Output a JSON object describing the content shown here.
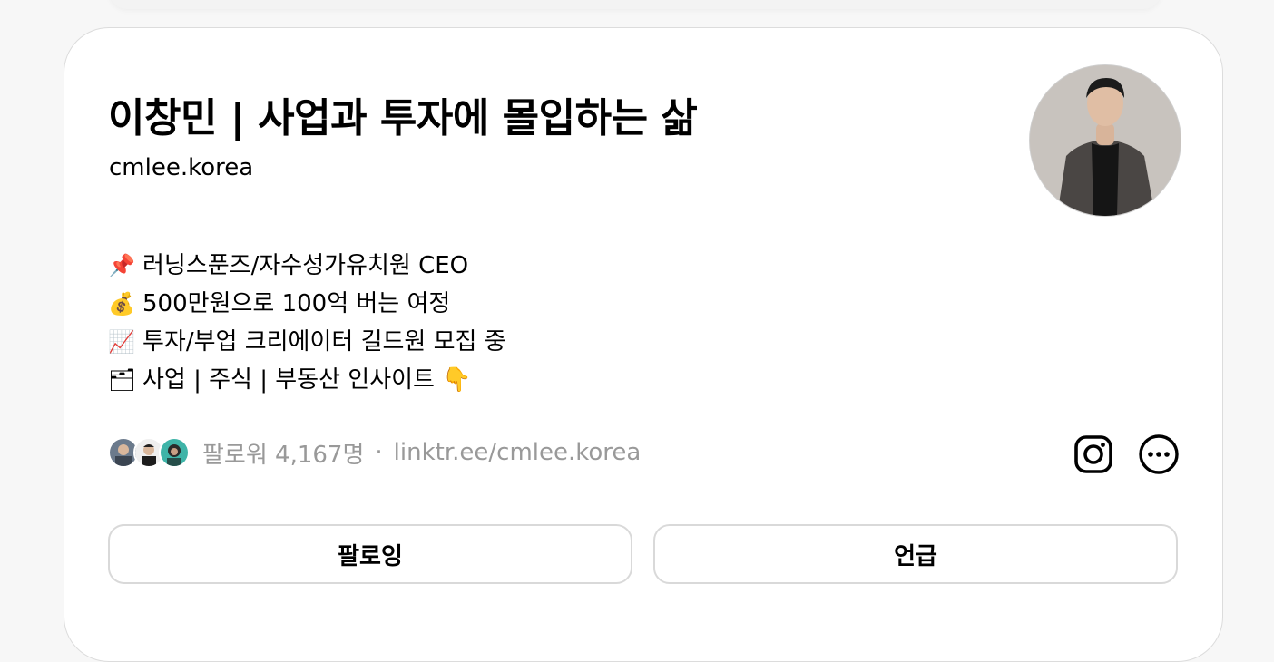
{
  "profile": {
    "name": "이창민 | 사업과 투자에 몰입하는 삶",
    "handle": "cmlee.korea",
    "avatar_icon": "profile-photo"
  },
  "bio": [
    {
      "icon": "📌",
      "text": "러닝스푼즈/자수성가유치원 CEO"
    },
    {
      "icon": "💰",
      "text": "500만원으로 100억 버는 여정"
    },
    {
      "icon": "📈",
      "text": "투자/부업 크리에이터 길드원 모집 중"
    },
    {
      "icon": "🗂",
      "text": "사업 | 주식 | 부동산 인사이트 👇"
    }
  ],
  "meta": {
    "followers": "팔로워 4,167명",
    "separator": "·",
    "link": "linktr.ee/cmlee.korea"
  },
  "actions": {
    "instagram_icon": "instagram-icon",
    "more_icon": "more-options-icon",
    "follow_label": "팔로잉",
    "mention_label": "언급"
  },
  "colors": {
    "muted_text": "#999999",
    "border": "#d9d9d9",
    "card_bg": "#ffffff",
    "page_bg": "#f7f7f7"
  }
}
